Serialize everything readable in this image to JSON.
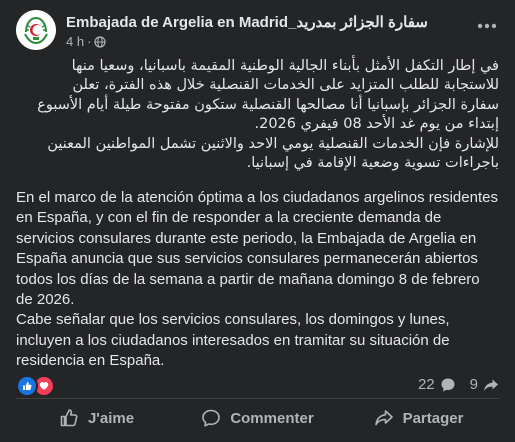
{
  "post": {
    "author": "Embajada de Argelia en Madrid_سفارة الجزائر بمدريد",
    "time": "4 h",
    "privacy_icon": "globe-icon",
    "menu_icon": "more-options-icon",
    "arabic_paragraphs": [
      "في إطار التكفل الأمثل بأبناء الجالية الوطنية المقيمة باسبانيا، وسعيا منها للاستجابة للطلب المتزايد على الخدمات القنصلية خلال هذه الفترة، تعلن سفارة الجزائر بإسبانيا أنا مصالحها القنصلية ستكون مفتوحة طيلة أيام الأسبوع إبتداء من يوم غد الأحد 08 فيفري 2026.",
      "للإشارة فإن الخدمات القنصلية يومي الاحد والاثنين تشمل المواطنين المعنين باجراءات تسوية وضعية الإقامة في إسبانيا."
    ],
    "spanish_paragraphs": [
      "En el marco de la atención óptima a los ciudadanos argelinos residentes en España, y con el fin de responder a la creciente demanda de servicios consulares durante este periodo, la Embajada de Argelia en España anuncia que sus servicios consulares permanecerán abiertos todos los días de la semana a partir de mañana domingo 8 de febrero de 2026.",
      "Cabe señalar que los servicios consulares, los domingos y lunes, incluyen a los ciudadanos interesados en tramitar su situación de residencia en España."
    ]
  },
  "stats": {
    "reactions": [
      "like-icon",
      "love-icon"
    ],
    "comments_count": "22",
    "shares_count": "9"
  },
  "actions": {
    "like": "J'aime",
    "comment": "Commenter",
    "share": "Partager"
  },
  "colors": {
    "background": "#242526",
    "text": "#e4e6eb",
    "muted": "#b0b3b8",
    "like": "#1b74e4",
    "love": "#f33e58"
  }
}
